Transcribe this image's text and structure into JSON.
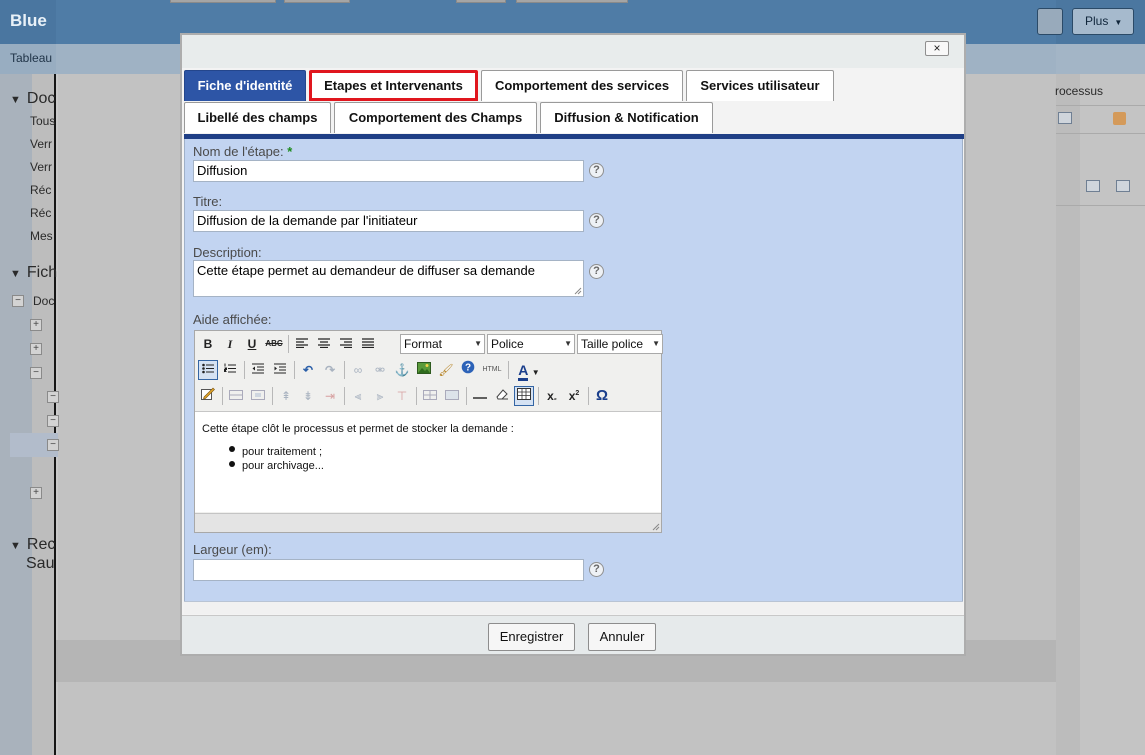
{
  "background": {
    "logo": "Blue",
    "subtab": "Tableau",
    "plus_label": "Plus",
    "left_items": [
      "Doc",
      "Tous",
      "Verr",
      "Verr",
      "Réc",
      "Réc",
      "Mes",
      "Fich",
      "Doc",
      "Rec",
      "Sau"
    ],
    "right_text": "rocessus"
  },
  "modal": {
    "close_label": "×",
    "tabs": [
      {
        "label": "Fiche d'identité",
        "active": true
      },
      {
        "label": "Etapes et Intervenants",
        "highlighted": true
      },
      {
        "label": "Comportement des services"
      },
      {
        "label": "Services utilisateur"
      },
      {
        "label": "Libellé des champs"
      },
      {
        "label": "Comportement des Champs"
      },
      {
        "label": "Diffusion & Notification"
      }
    ],
    "fields": {
      "step_name": {
        "label": "Nom de l'étape:",
        "required_mark": "*",
        "value": "Diffusion"
      },
      "title": {
        "label": "Titre:",
        "value": "Diffusion de la demande par l'initiateur"
      },
      "description": {
        "label": "Description:",
        "value": "Cette étape permet au demandeur de diffuser sa demande"
      },
      "help_text": {
        "label": "Aide affichée:"
      },
      "width": {
        "label": "Largeur (em):",
        "value": ""
      }
    },
    "editor": {
      "format_select": "Format",
      "font_select": "Police",
      "size_select": "Taille police",
      "content_paragraph": "Cette étape clôt le processus et permet de stocker la demande :",
      "content_items": [
        "pour traitement ;",
        "pour archivage..."
      ],
      "html_button": "HTML"
    },
    "help_icon": "?",
    "buttons": {
      "save": "Enregistrer",
      "cancel": "Annuler"
    }
  },
  "colors": {
    "active_tab": "#2d55a6",
    "highlight_border": "#e0161e",
    "panel_bg": "#c2d4f1"
  }
}
